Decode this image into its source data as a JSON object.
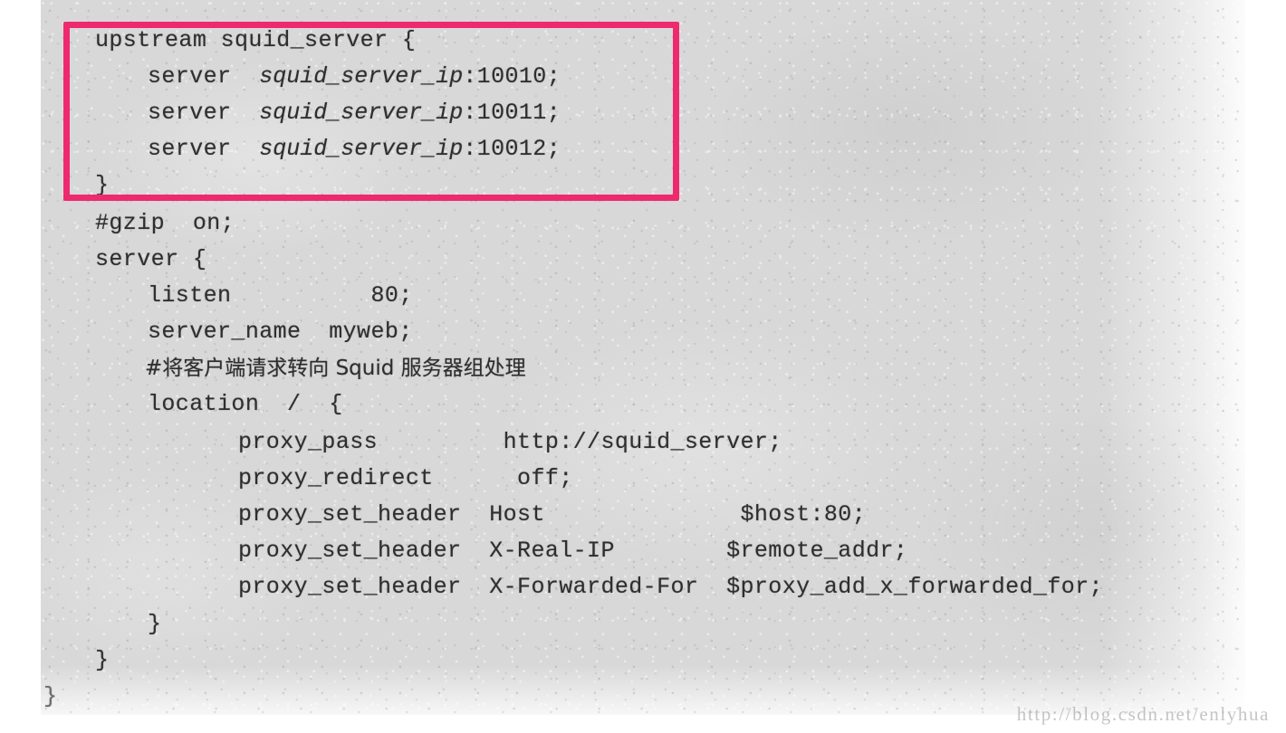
{
  "document": {
    "kind": "scanned-book-page",
    "language": "nginx-config",
    "highlight_color": "#ee2a6e",
    "paper_color": "#d8d8d8",
    "text_color": "#2e2e2e"
  },
  "watermark": {
    "text": "http://blog.csdn.net/enlyhua"
  },
  "code": {
    "lines": [
      {
        "indent": 0,
        "text": "upstream squid_server {"
      },
      {
        "indent": 1,
        "text": "server  squid_server_ip:10010;"
      },
      {
        "indent": 1,
        "text": "server  squid_server_ip:10011;"
      },
      {
        "indent": 1,
        "text": "server  squid_server_ip:10012;"
      },
      {
        "indent": 0,
        "text": "}"
      },
      {
        "indent": 0,
        "text": "#gzip  on;"
      },
      {
        "indent": 0,
        "text": "server {"
      },
      {
        "indent": 1,
        "text": "listen          80;"
      },
      {
        "indent": 1,
        "text": "server_name  myweb;"
      },
      {
        "indent": 1,
        "text": "#将客户端请求转向 Squid 服务器组处理"
      },
      {
        "indent": 1,
        "text": "location  /  {"
      },
      {
        "indent": 2,
        "text": "proxy_pass         http://squid_server;"
      },
      {
        "indent": 2,
        "text": "proxy_redirect      off;"
      },
      {
        "indent": 2,
        "text": "proxy_set_header  Host              $host:80;"
      },
      {
        "indent": 2,
        "text": "proxy_set_header  X-Real-IP        $remote_addr;"
      },
      {
        "indent": 2,
        "text": "proxy_set_header  X-Forwarded-For  $proxy_add_x_forwarded_for;"
      },
      {
        "indent": 1,
        "text": "}"
      },
      {
        "indent": 0,
        "text": "}"
      },
      {
        "indent": 0,
        "text": "}"
      }
    ],
    "line_01_prefix": "upstream squid_server {",
    "line_02_kw": "server  ",
    "line_02_var": "squid_server_ip",
    "line_02_port": ":10010;",
    "line_03_kw": "server  ",
    "line_03_var": "squid_server_ip",
    "line_03_port": ":10011;",
    "line_04_kw": "server  ",
    "line_04_var": "squid_server_ip",
    "line_04_port": ":10012;",
    "line_05": "}",
    "line_06": "#gzip  on;",
    "line_07": "server {",
    "line_08": "listen          80;",
    "line_09": "server_name  myweb;",
    "line_10": "#将客户端请求转向 Squid 服务器组处理",
    "line_11": "location  /  {",
    "line_12": "proxy_pass         http://squid_server;",
    "line_13": "proxy_redirect      off;",
    "line_14": "proxy_set_header  Host              $host:80;",
    "line_15": "proxy_set_header  X-Real-IP        $remote_addr;",
    "line_16": "proxy_set_header  X-Forwarded-For  $proxy_add_x_forwarded_for;",
    "line_17": "}",
    "line_18": "}",
    "line_19": "}"
  }
}
